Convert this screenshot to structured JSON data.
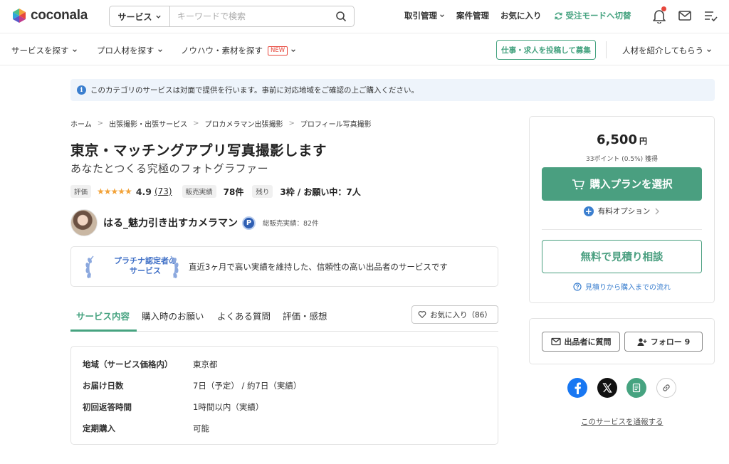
{
  "header": {
    "logo_text": "coconala",
    "search": {
      "category": "サービス",
      "placeholder": "キーワードで検索",
      "value": ""
    },
    "links": {
      "transactions": "取引管理",
      "messages": "案件管理",
      "favorites": "お気に入り",
      "mode_switch": "受注モードへ切替"
    },
    "icons": [
      "bell-icon",
      "mail-icon",
      "task-list-icon"
    ]
  },
  "subnav": {
    "items": [
      "サービスを探す",
      "プロ人材を探す",
      "ノウハウ・素材を探す"
    ],
    "new_badge": "NEW",
    "post_button": "仕事・求人を投稿して募集",
    "refer": "人材を紹介してもらう"
  },
  "notice": {
    "text": "このカテゴリのサービスは対面で提供を行います。事前に対応地域をご確認の上ご購入ください。"
  },
  "breadcrumb": [
    "ホーム",
    "出張撮影・出張サービス",
    "プロカメラマン出張撮影",
    "プロフィール写真撮影"
  ],
  "service": {
    "title": "東京・マッチングアプリ写真撮影します",
    "subtitle": "あなたとつくる究極のフォトグラファー",
    "rating_label": "評価",
    "stars": "★★★★★",
    "rating_value": "4.9",
    "rating_count": "(73)",
    "sales_label": "販売実績",
    "sales_value": "78件",
    "remaining_label": "残り",
    "remaining_value": "3枠 / お願い中：7人"
  },
  "seller": {
    "name": "はる_魅力引き出すカメラマン",
    "badge": "P",
    "total_sales": "総販売実績：82件"
  },
  "platinum": {
    "label_line1": "プラチナ認定者の",
    "label_line2": "サービス",
    "description": "直近3ヶ月で高い実績を維持した、信頼性の高い出品者のサービスです"
  },
  "tabs": {
    "items": [
      "サービス内容",
      "購入時のお願い",
      "よくある質問",
      "評価・感想"
    ],
    "favorite_button": "お気に入り（86）"
  },
  "spec": {
    "rows": [
      {
        "label": "地域（サービス価格内）",
        "value": "東京都"
      },
      {
        "label": "お届け日数",
        "value": "7日（予定） / 約7日（実績）"
      },
      {
        "label": "初回返答時間",
        "value": "1時間以内（実績）"
      },
      {
        "label": "定期購入",
        "value": "可能"
      }
    ]
  },
  "buybox": {
    "price": "6,500",
    "currency": "円",
    "points": "33ポイント (0.5%) 獲得",
    "buy_button": "購入プランを選択",
    "option": "有料オプション",
    "quote_button": "無料で見積り相談",
    "flow_link": "見積りから購入までの流れ"
  },
  "sellerbox": {
    "ask_button": "出品者に質問",
    "follow_button": "フォロー 9"
  },
  "share": {
    "icons": [
      "facebook-icon",
      "x-icon",
      "note-icon",
      "link-icon"
    ]
  },
  "report_link": "このサービスを通報する",
  "colors": {
    "brand_green": "#4a9f80",
    "link_blue": "#3b7fcf",
    "platinum_blue": "#3f6fc6",
    "accent_red": "#e7473c"
  }
}
